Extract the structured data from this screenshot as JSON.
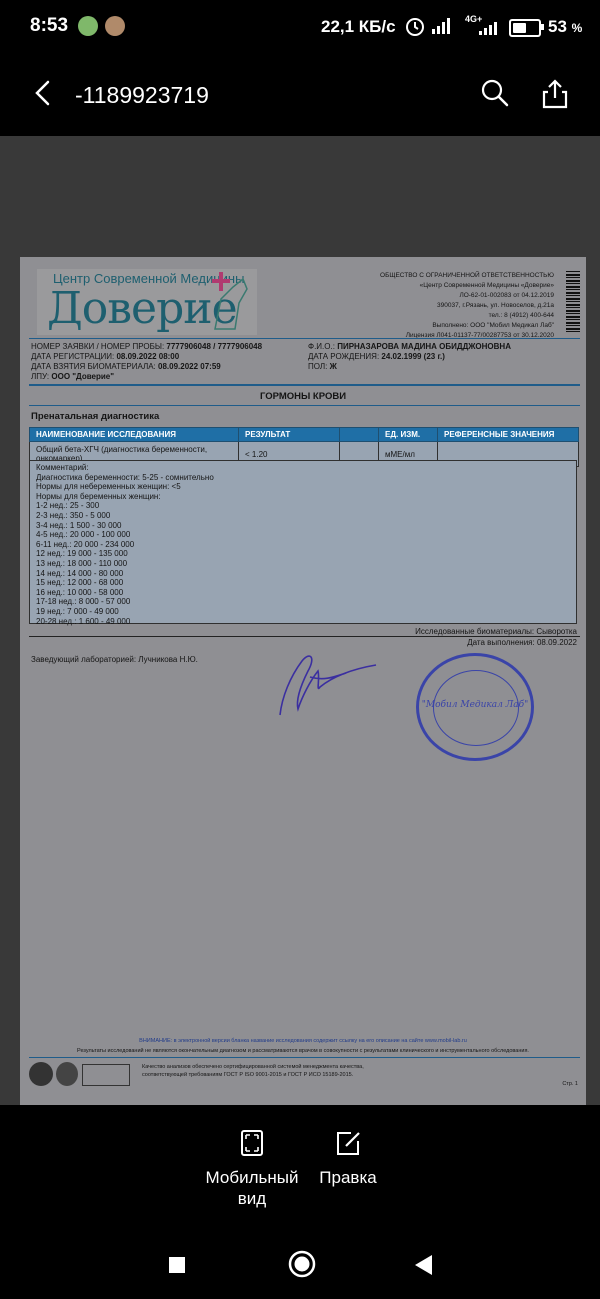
{
  "status": {
    "time": "8:53",
    "net_speed": "22,1 КБ/с",
    "network": "4G+",
    "battery_pct": "53",
    "battery_unit": "%"
  },
  "topbar": {
    "title": "-1189923719",
    "icons": [
      "back-arrow-icon",
      "search-icon",
      "share-icon"
    ]
  },
  "document": {
    "logo_top": "Центр Современной Медицины",
    "logo_main": "Доверие",
    "org_lines": [
      "ОБЩЕСТВО С ОГРАНИЧЕННОЙ ОТВЕТСТВЕННОСТЬЮ",
      "«Центр Современной Медицины «Доверие»",
      "ЛО-62-01-002083 от 04.12.2019",
      "390037, г.Рязань, ул. Новоселов, д.21а",
      "тел.: 8 (4912) 400-644",
      "Выполнено: ООО \"Мобил Медикал Лаб\"",
      "Лицензия Л041-01137-77/00287753 от 30.12.2020"
    ],
    "fields_left": [
      {
        "label": "НОМЕР ЗАЯВКИ / НОМЕР ПРОБЫ:",
        "value": "7777906048 / 7777906048"
      },
      {
        "label": "ДАТА РЕГИСТРАЦИИ:",
        "value": "08.09.2022 08:00"
      },
      {
        "label": "ДАТА ВЗЯТИЯ БИОМАТЕРИАЛА:",
        "value": "08.09.2022 07:59"
      },
      {
        "label": "ЛПУ:",
        "value": "ООО \"Доверие\""
      }
    ],
    "fields_right": [
      {
        "label": "Ф.И.О.:",
        "value": "ПИРНАЗАРОВА МАДИНА ОБИДДЖОНОВНА"
      },
      {
        "label": "ДАТА РОЖДЕНИЯ:",
        "value": "24.02.1999 (23 г.)"
      },
      {
        "label": "ПОЛ:",
        "value": "Ж"
      }
    ],
    "section_title": "ГОРМОНЫ КРОВИ",
    "subsection": "Пренатальная диагностика",
    "table_headers": [
      "НАИМЕНОВАНИЕ ИССЛЕДОВАНИЯ",
      "РЕЗУЛЬТАТ",
      "",
      "ЕД. ИЗМ.",
      "РЕФЕРЕНСНЫЕ ЗНАЧЕНИЯ"
    ],
    "row": {
      "name": "Общий бета-ХГЧ (диагностика беременности, онкомаркер)",
      "result": "< 1.20",
      "flag": "",
      "unit": "мМЕ/мл",
      "reference": ""
    },
    "comment_lines": [
      "Комментарий:",
      "Диагностика беременности: 5-25 - сомнительно",
      "Нормы для небеременных женщин: <5",
      "Нормы для беременных женщин:",
      "1-2 нед.: 25 - 300",
      "2-3 нед.: 350 - 5 000",
      "3-4 нед.: 1 500 - 30 000",
      "4-5 нед.: 20 000 - 100 000",
      "6-11 нед.: 20 000 - 234 000",
      "12 нед.: 19 000 - 135 000",
      "13 нед.: 18 000 - 110 000",
      "14 нед.: 14 000 - 80 000",
      "15 нед.: 12 000 - 68 000",
      "16 нед.: 10 000 - 58 000",
      "17-18 нед.: 8 000 - 57 000",
      "19 нед.: 7 000 - 49 000",
      "20-28 нед.: 1 600 - 49 000"
    ],
    "biomaterial": "Исследованные биоматериалы: Сыворотка",
    "completion_date": "Дата выполнения: 08.09.2022",
    "head": "Заведующий лабораторией: Лучникова Н.Ю.",
    "stamp_text": "\"Мобил Медикал Лаб\"",
    "footer_attention": "ВНИМАНИЕ: в электронной версии бланка название исследования содержит ссылку на его описание на сайте www.mobil-lab.ru",
    "footer_disclaimer": "Результаты исследований не являются окончательным диагнозом и рассматриваются врачом в совокупности с результатами клинического и инструментального обследования.",
    "footer_quality_1": "Качество анализов обеспечено сертифицированной системой менеджмента качества,",
    "footer_quality_2": "соответствующей требованиям ГОСТ Р ISO 9001-2015 и ГОСТ Р ИСО 15189-2015.",
    "page": "Стр. 1",
    "colors": {
      "header_blue": "#1f6fa6",
      "stamp_blue": "#3a44a8",
      "signature": "#3b2fa0"
    }
  },
  "bottom_actions": [
    {
      "label_line1": "Мобильный",
      "label_line2": "вид",
      "icon": "mobile-view-icon"
    },
    {
      "label_line1": "Правка",
      "label_line2": "",
      "icon": "edit-icon"
    }
  ],
  "nav": [
    "recents-square-icon",
    "home-circle-icon",
    "back-triangle-icon"
  ]
}
